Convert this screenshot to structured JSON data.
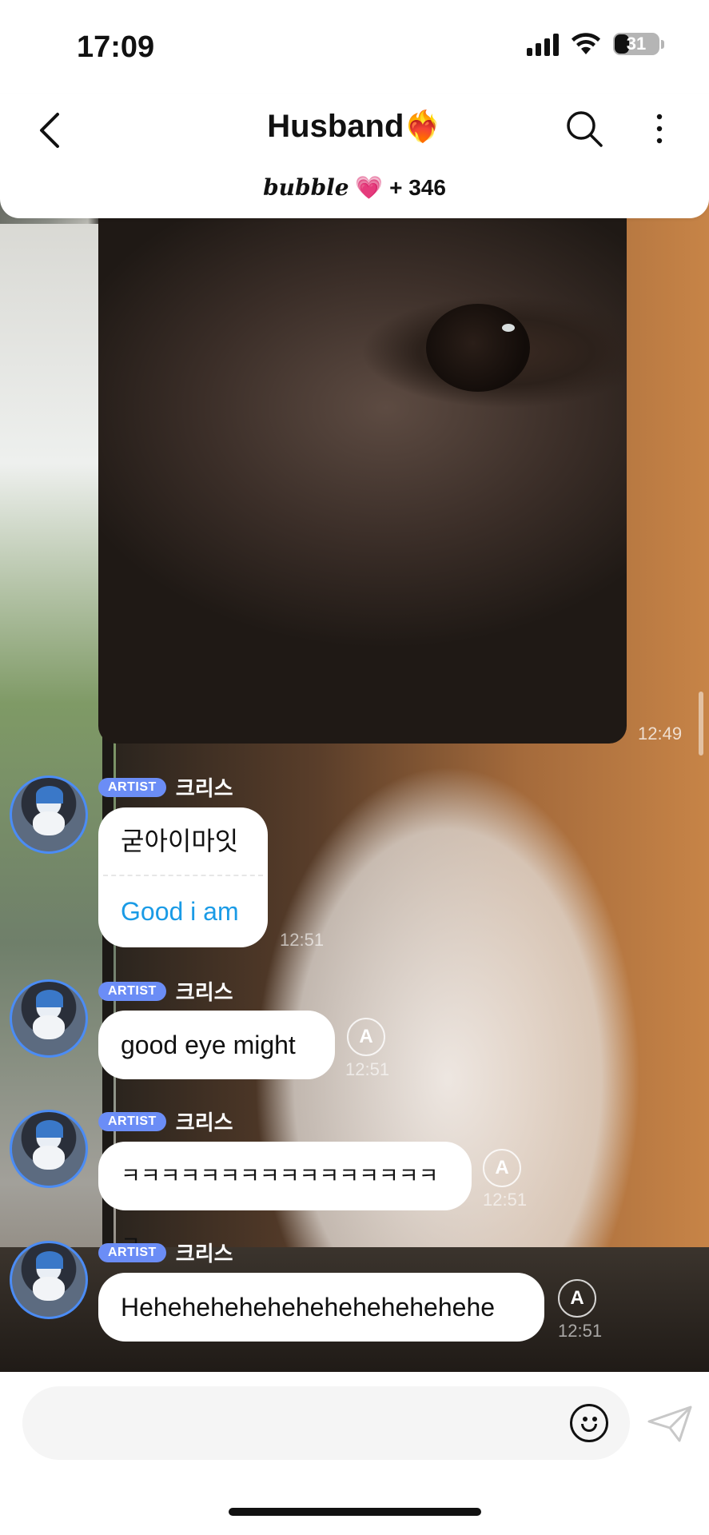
{
  "status": {
    "time": "17:09",
    "battery": "31"
  },
  "header": {
    "title": "Husband",
    "title_emoji": "❤️‍🔥",
    "brand": "bubble",
    "heart": "💗",
    "count": "+ 346"
  },
  "photo_message": {
    "time": "12:49"
  },
  "messages": [
    {
      "badge": "ARTIST",
      "name": "크리스",
      "text": "굳아이마잇",
      "translation": "Good i am",
      "time": "12:51"
    },
    {
      "badge": "ARTIST",
      "name": "크리스",
      "text": "good eye might",
      "time": "12:51",
      "translate_icon": "A"
    },
    {
      "badge": "ARTIST",
      "name": "크리스",
      "text": "ㅋㅋㅋㅋㅋㅋㅋㅋㅋㅋㅋㅋㅋㅋㅋㅋㅋ",
      "time": "12:51",
      "translate_icon": "A"
    },
    {
      "badge": "ARTIST",
      "name": "크리스",
      "text": "Hehehehehehehehehehehehehe",
      "time": "12:51",
      "translate_icon": "A"
    }
  ],
  "input": {
    "placeholder": ""
  }
}
